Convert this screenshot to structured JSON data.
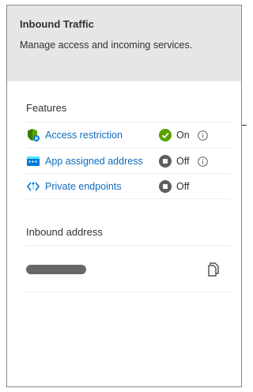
{
  "panel": {
    "title": "Inbound Traffic",
    "subtitle": "Manage access and incoming services."
  },
  "features": {
    "heading": "Features",
    "items": [
      {
        "label": "Access restriction",
        "status": "On",
        "icon": "shield-icon",
        "status_icon": "check-circle-icon",
        "has_info": true
      },
      {
        "label": "App assigned address",
        "status": "Off",
        "icon": "network-address-icon",
        "status_icon": "stop-circle-icon",
        "has_info": true
      },
      {
        "label": "Private endpoints",
        "status": "Off",
        "icon": "private-endpoint-icon",
        "status_icon": "stop-circle-icon",
        "has_info": false
      }
    ]
  },
  "inbound_address": {
    "heading": "Inbound address",
    "copy_icon": "copy-icon"
  },
  "colors": {
    "link": "#0f6cbd",
    "status_on": "#57a300",
    "status_off": "#605e5c",
    "header_bg": "#e6e6e6"
  }
}
